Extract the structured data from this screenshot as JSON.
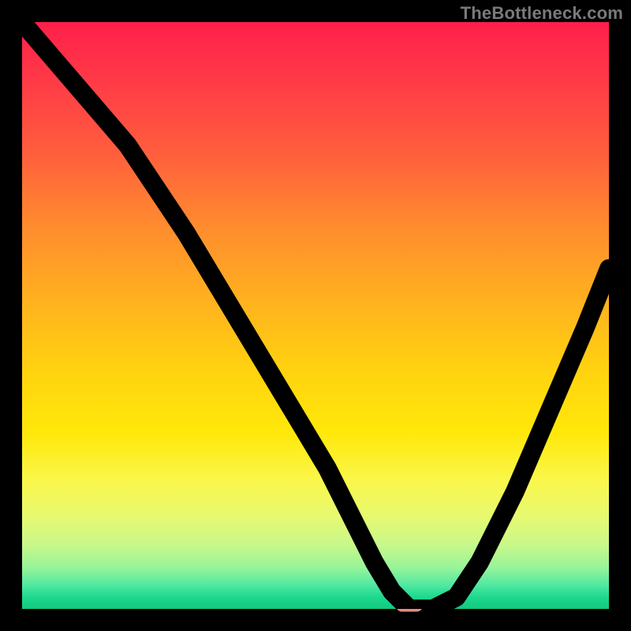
{
  "watermark": "TheBottleneck.com",
  "chart_data": {
    "type": "line",
    "title": "",
    "xlabel": "",
    "ylabel": "",
    "xlim": [
      0,
      100
    ],
    "ylim": [
      0,
      100
    ],
    "series": [
      {
        "name": "bottleneck-curve",
        "x": [
          0,
          6,
          12,
          18,
          22,
          28,
          34,
          40,
          46,
          52,
          56,
          60,
          63,
          66,
          70,
          74,
          78,
          84,
          90,
          96,
          100
        ],
        "y": [
          100,
          93,
          86,
          79,
          73,
          64,
          54,
          44,
          34,
          24,
          16,
          8,
          3,
          0,
          0,
          2,
          8,
          20,
          34,
          48,
          58
        ]
      }
    ],
    "annotations": [
      {
        "name": "optimal-marker",
        "x": 66,
        "y": 0.5
      }
    ],
    "background_gradient": {
      "top": "#ff1f4a",
      "mid": "#ffd40f",
      "bottom": "#12c97f"
    }
  }
}
